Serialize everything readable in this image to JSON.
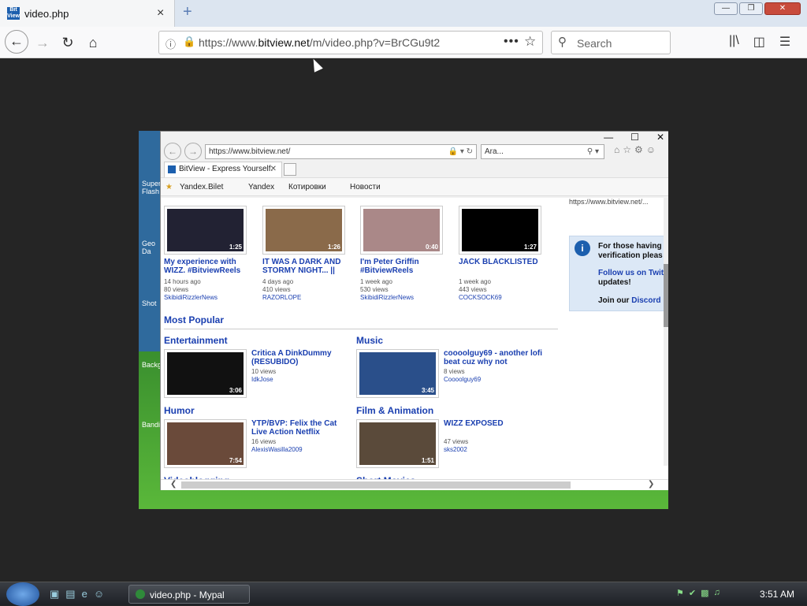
{
  "browser": {
    "tab_title": "video.php",
    "favicon_text": "Bit View",
    "url_host": "https://www.",
    "url_domain": "bitview.net",
    "url_path": "/m/video.php?v=BrCGu9t2",
    "search_placeholder": "Search",
    "close_glyph": "×",
    "new_tab_glyph": "+"
  },
  "desktop_icons": [
    {
      "label": "Super Flash"
    },
    {
      "label": "Geo Da"
    },
    {
      "label": "Shot"
    },
    {
      "label": "Backgr"
    },
    {
      "label": "Bandi"
    }
  ],
  "ie": {
    "address": "https://www.bitview.net/",
    "search_value": "Ara...",
    "tab_title": "BitView - Express Yourself.",
    "favorites": [
      "Yandex.Bilet",
      "Yandex",
      "Котировки",
      "Новости"
    ]
  },
  "recent_videos": [
    {
      "title": "My experience with WIZZ. #BitviewReels",
      "duration": "1:25",
      "age": "14 hours ago",
      "views": "80 views",
      "user": "SkibidiRizzlerNews",
      "color": "#223"
    },
    {
      "title": "IT WAS A DARK AND STORMY NIGHT... ||",
      "duration": "1:26",
      "age": "4 days ago",
      "views": "410 views",
      "user": "RAZORLOPE",
      "color": "#8a6a4a"
    },
    {
      "title": "I'm Peter Griffin #BitviewReels",
      "duration": "0:40",
      "age": "1 week ago",
      "views": "530 views",
      "user": "SkibidiRizzlerNews",
      "color": "#a88"
    },
    {
      "title": "JACK BLACKLISTED",
      "duration": "1:27",
      "age": "1 week ago",
      "views": "443 views",
      "user": "COCKSOCK69",
      "color": "#000"
    }
  ],
  "most_popular_title": "Most Popular",
  "categories": [
    {
      "name": "Entertainment",
      "video": {
        "title": "Critica A DinkDummy (RESUBIDO)",
        "duration": "3:06",
        "views": "10 views",
        "user": "IdkJose",
        "color": "#111"
      }
    },
    {
      "name": "Music",
      "video": {
        "title": "coooolguy69 - another lofi beat cuz why not",
        "duration": "3:45",
        "views": "8 views",
        "user": "Coooolguy69",
        "color": "#2a4f8a"
      }
    },
    {
      "name": "Humor",
      "video": {
        "title": "YTP/BVP: Felix the Cat Live Action Netflix",
        "duration": "7:54",
        "views": "16 views",
        "user": "AlexisWasilla2009",
        "color": "#6a4a3a"
      }
    },
    {
      "name": "Film & Animation",
      "video": {
        "title": "WIZZ EXPOSED",
        "duration": "1:51",
        "views": "47 views",
        "user": "sks2002",
        "color": "#5a4a3a"
      }
    }
  ],
  "partial_sections": [
    "Videoblogging",
    "Short Movies"
  ],
  "sidebar": {
    "url_text": "https://www.bitview.net/...",
    "notice_line1": "For those having verification pleas",
    "notice_link": "Follow us on Twit",
    "notice_line2": "updates!",
    "notice_line3_prefix": "Join our ",
    "notice_line3_link": "Discord"
  },
  "taskbar": {
    "task_label": "video.php - Mypal",
    "clock": "3:51 AM"
  }
}
